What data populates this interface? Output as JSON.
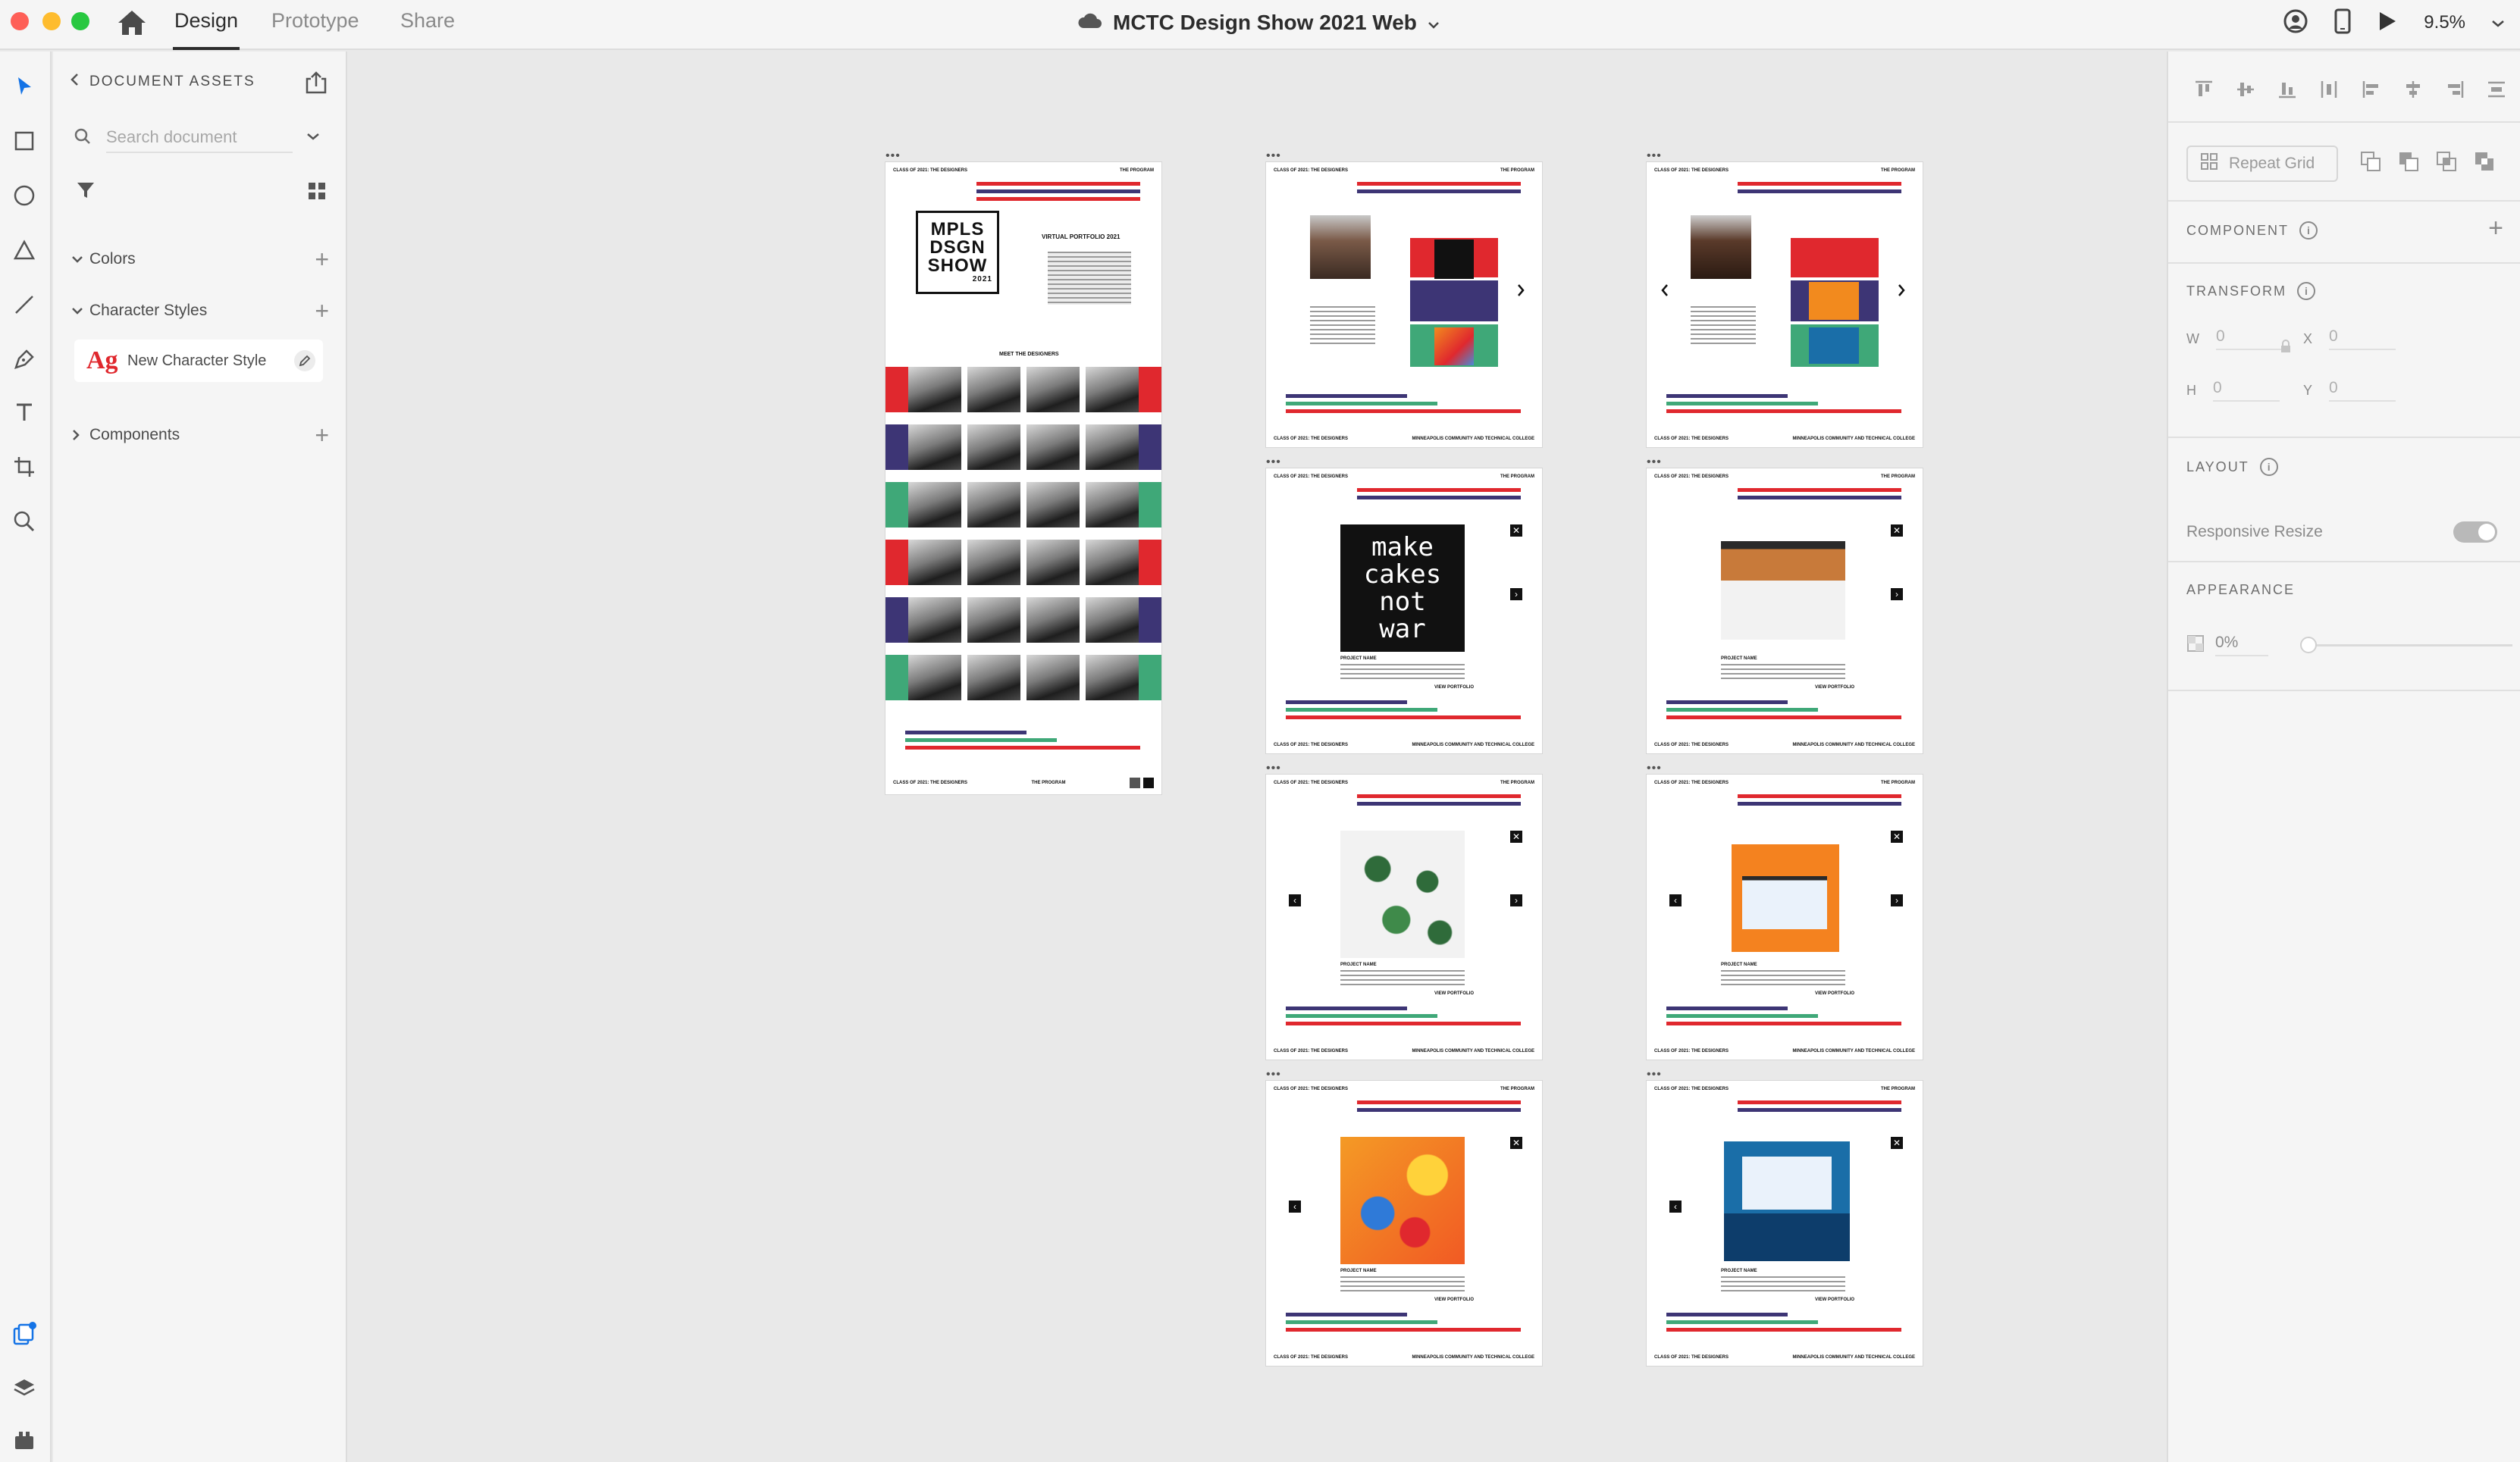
{
  "window": {
    "tabs": [
      {
        "label": "Design"
      },
      {
        "label": "Prototype"
      },
      {
        "label": "Share"
      }
    ],
    "document_title": "MCTC Design Show 2021 Web",
    "zoom": "9.5%"
  },
  "assets_panel": {
    "header": "DOCUMENT ASSETS",
    "search_placeholder": "Search document",
    "sections": {
      "colors": "Colors",
      "character_styles": "Character Styles",
      "components": "Components"
    },
    "character_style_item": {
      "glyph": "Ag",
      "name": "New Character Style"
    }
  },
  "artboards": {
    "header_left": "CLASS OF 2021: THE DESIGNERS",
    "header_right": "THE PROGRAM",
    "footer_right_line1": "MINNEAPOLIS COMMUNITY AND TECHNICAL COLLEGE",
    "home": {
      "logo_lines": [
        "MPLS",
        "DSGN",
        "SHOW"
      ],
      "logo_year": "2021",
      "virtual_portfolio": "VIRTUAL PORTFOLIO 2021",
      "meet": "MEET THE DESIGNERS"
    },
    "project": {
      "project_name": "PROJECT NAME",
      "view_portfolio": "VIEW PORTFOLIO",
      "poster_text": [
        "make",
        "cakes",
        "not",
        "war"
      ]
    }
  },
  "inspector": {
    "repeat_grid": "Repeat Grid",
    "component": "COMPONENT",
    "transform": "TRANSFORM",
    "w_label": "W",
    "w_value": "0",
    "x_label": "X",
    "x_value": "0",
    "h_label": "H",
    "h_value": "0",
    "y_label": "Y",
    "y_value": "0",
    "layout": "LAYOUT",
    "responsive_resize": "Responsive Resize",
    "appearance": "APPEARANCE",
    "opacity": "0%"
  },
  "colors": {
    "accent_red": "#e0282e",
    "accent_navy": "#3d3575",
    "accent_green": "#3fa878",
    "accent_blue": "#1473e6"
  }
}
